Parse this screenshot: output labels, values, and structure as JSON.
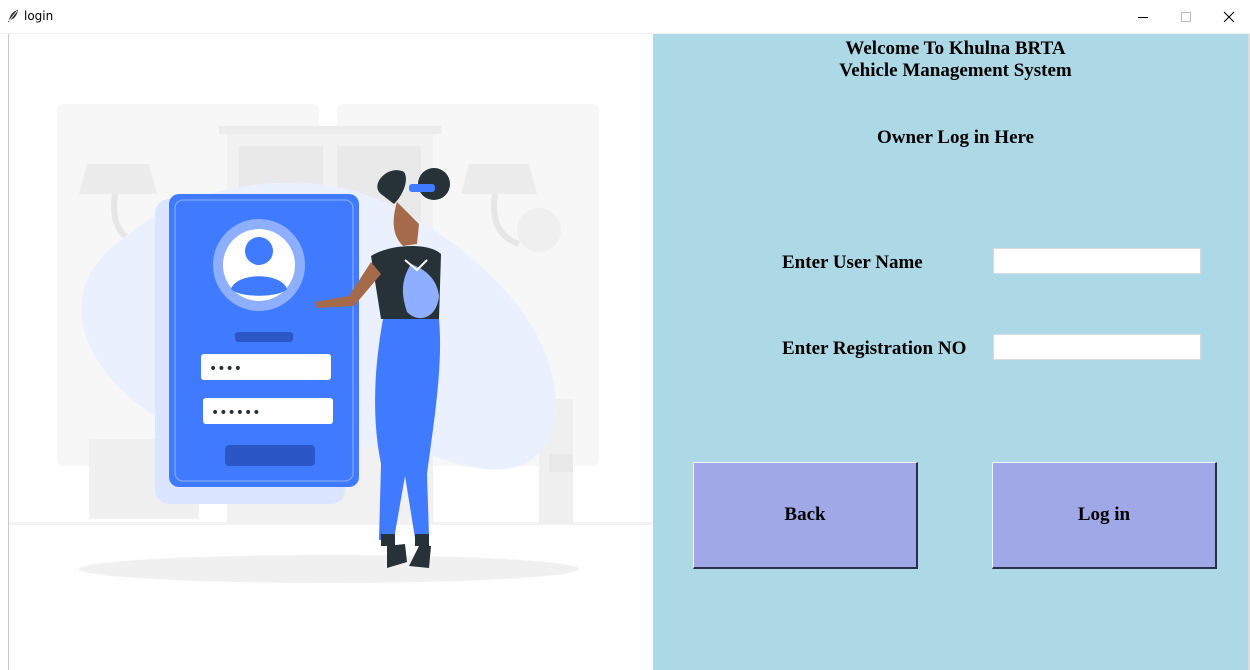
{
  "window": {
    "title": "login",
    "icon": "feather-icon",
    "controls": [
      "minimize-icon",
      "maximize-icon",
      "close-icon"
    ]
  },
  "illustration": {
    "description_icon": "login-illustration",
    "password_dots_1": "••••",
    "password_dots_2": "••••••"
  },
  "panel": {
    "welcome_line1": "Welcome To Khulna BRTA",
    "welcome_line2": "Vehicle Management System",
    "subtitle": "Owner Log in Here",
    "username_label": "Enter User Name",
    "username_value": "",
    "registration_label": "Enter Registration NO",
    "registration_value": "",
    "back_label": "Back",
    "login_label": "Log in"
  },
  "colors": {
    "panel_bg": "#add8e6",
    "button_bg": "#a0a8e8",
    "accent_blue": "#407bff"
  }
}
